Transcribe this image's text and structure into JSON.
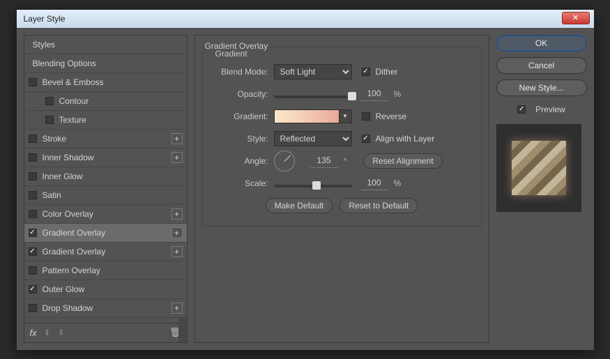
{
  "title": "Layer Style",
  "sidebar": {
    "styles_label": "Styles",
    "blending_label": "Blending Options",
    "items": [
      {
        "label": "Bevel & Emboss",
        "checked": false,
        "plus": false,
        "indent": 0
      },
      {
        "label": "Contour",
        "checked": false,
        "plus": false,
        "indent": 1
      },
      {
        "label": "Texture",
        "checked": false,
        "plus": false,
        "indent": 1
      },
      {
        "label": "Stroke",
        "checked": false,
        "plus": true,
        "indent": 0
      },
      {
        "label": "Inner Shadow",
        "checked": false,
        "plus": true,
        "indent": 0
      },
      {
        "label": "Inner Glow",
        "checked": false,
        "plus": false,
        "indent": 0
      },
      {
        "label": "Satin",
        "checked": false,
        "plus": false,
        "indent": 0
      },
      {
        "label": "Color Overlay",
        "checked": false,
        "plus": true,
        "indent": 0
      },
      {
        "label": "Gradient Overlay",
        "checked": true,
        "plus": true,
        "indent": 0,
        "selected": true
      },
      {
        "label": "Gradient Overlay",
        "checked": true,
        "plus": true,
        "indent": 0
      },
      {
        "label": "Pattern Overlay",
        "checked": false,
        "plus": false,
        "indent": 0
      },
      {
        "label": "Outer Glow",
        "checked": true,
        "plus": false,
        "indent": 0
      },
      {
        "label": "Drop Shadow",
        "checked": false,
        "plus": true,
        "indent": 0
      }
    ]
  },
  "panel": {
    "section_title": "Gradient Overlay",
    "legend": "Gradient",
    "blend_mode_label": "Blend Mode:",
    "blend_mode_value": "Soft Light",
    "dither_label": "Dither",
    "dither_checked": true,
    "opacity_label": "Opacity:",
    "opacity_value": "100",
    "opacity_unit": "%",
    "gradient_label": "Gradient:",
    "reverse_label": "Reverse",
    "reverse_checked": false,
    "style_label": "Style:",
    "style_value": "Reflected",
    "align_label": "Align with Layer",
    "align_checked": true,
    "angle_label": "Angle:",
    "angle_value": "135",
    "angle_unit": "°",
    "reset_alignment": "Reset Alignment",
    "scale_label": "Scale:",
    "scale_value": "100",
    "scale_unit": "%",
    "make_default": "Make Default",
    "reset_default": "Reset to Default"
  },
  "right": {
    "ok": "OK",
    "cancel": "Cancel",
    "new_style": "New Style...",
    "preview": "Preview",
    "preview_checked": true
  }
}
